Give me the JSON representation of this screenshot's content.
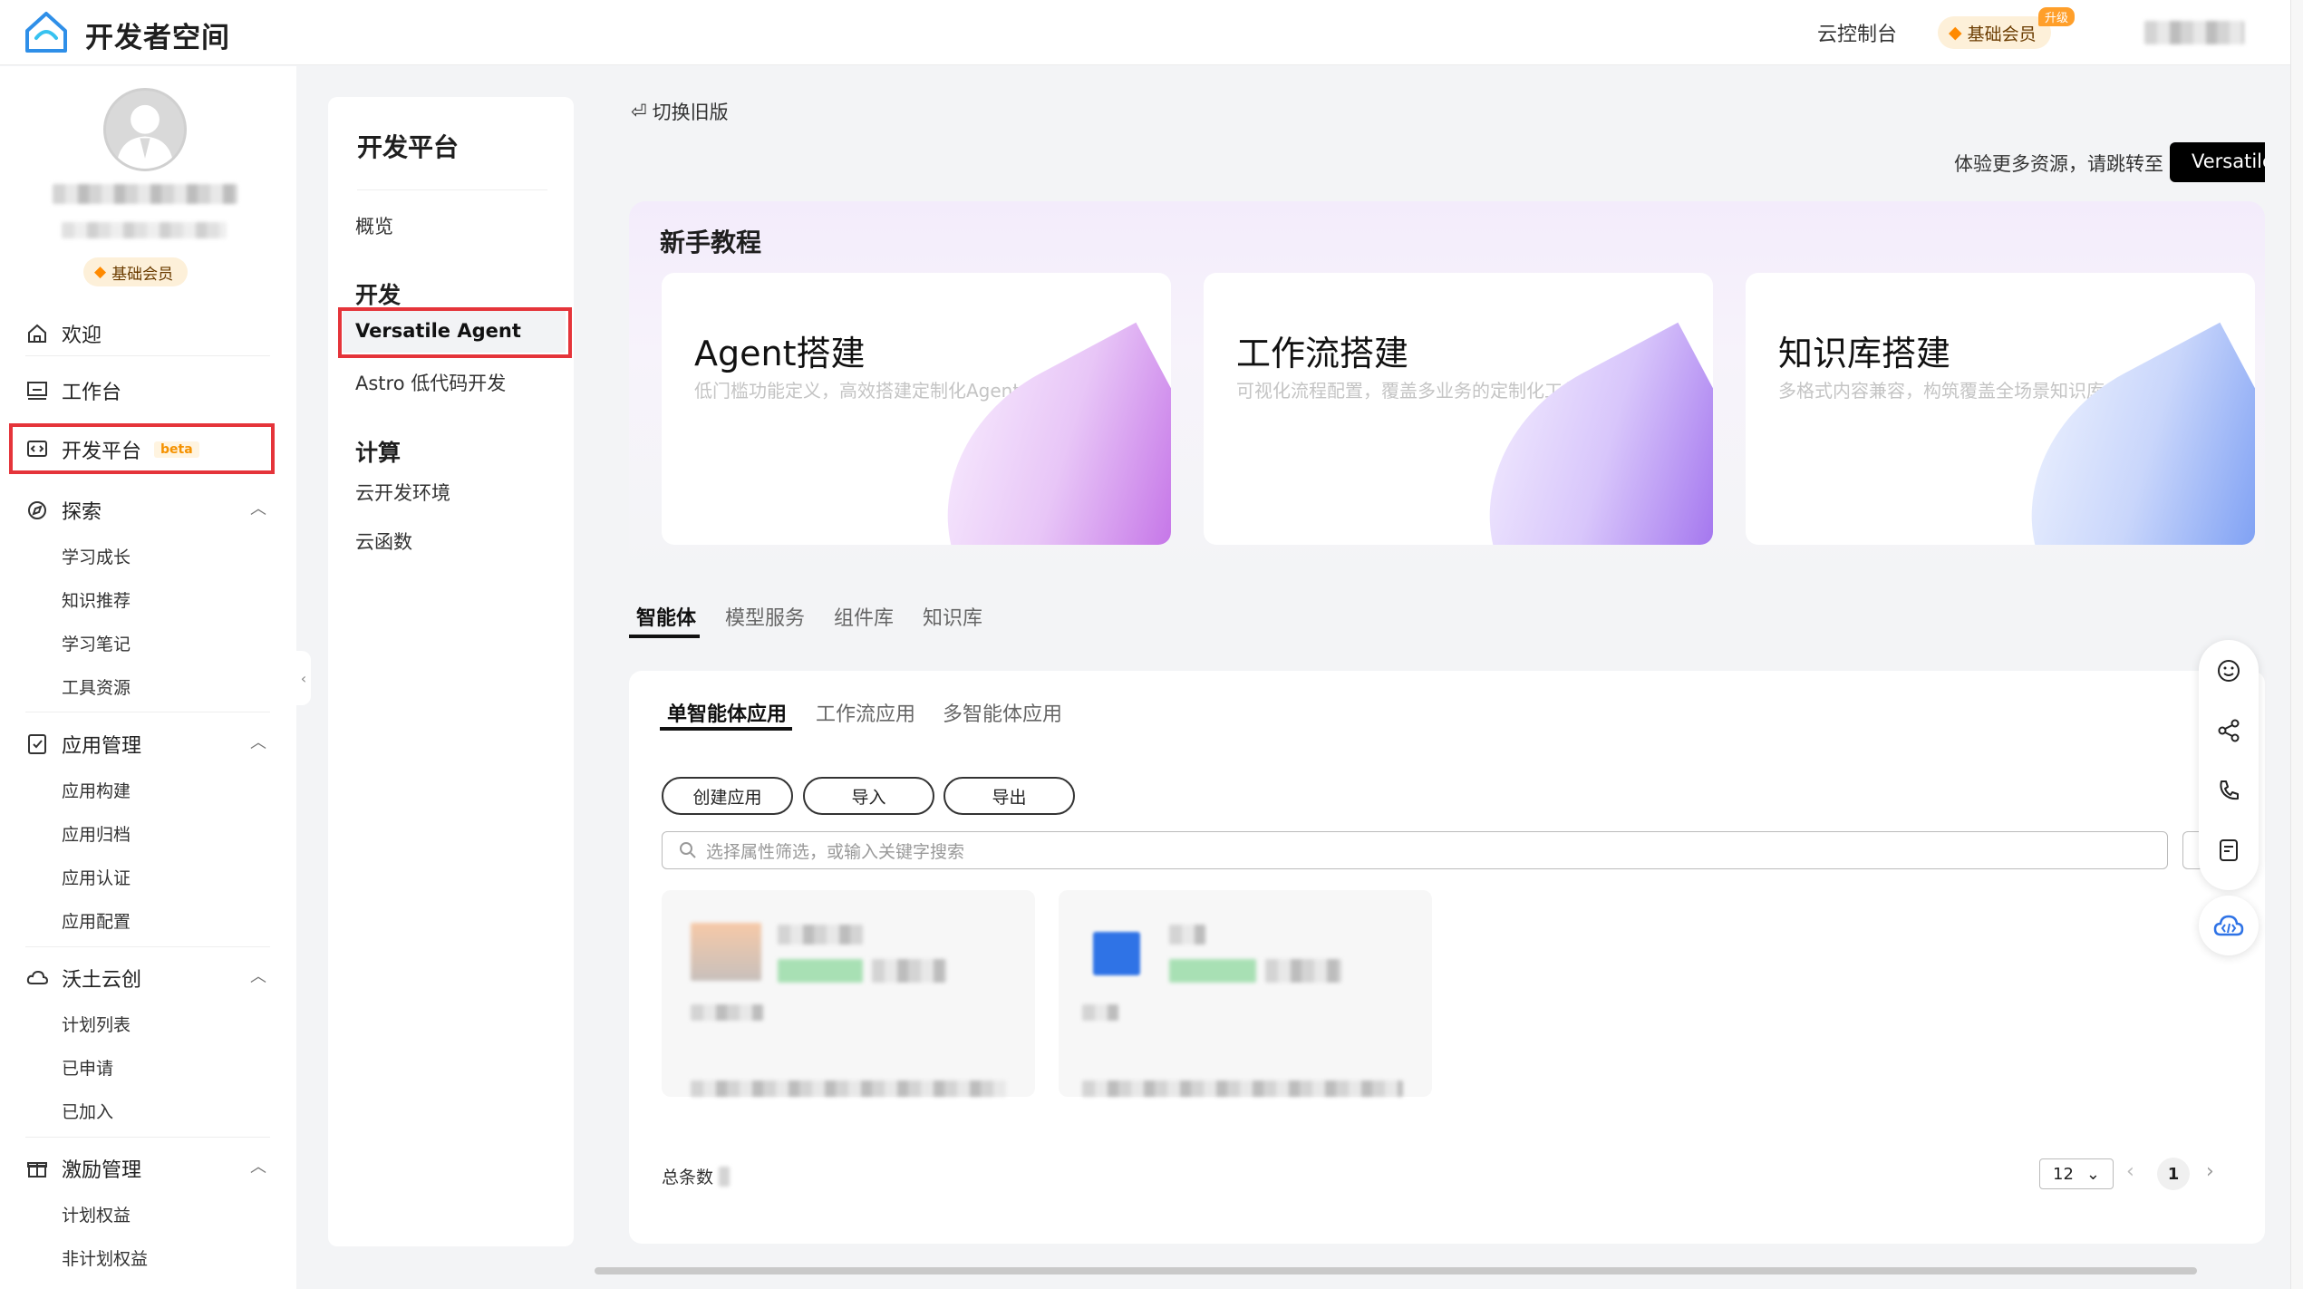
{
  "header": {
    "logo_text": "开发者空间",
    "console_label": "云控制台",
    "member_label": "基础会员",
    "upgrade_badge": "升级"
  },
  "profile": {
    "member_label": "基础会员"
  },
  "sidebar": {
    "items": [
      {
        "label": "欢迎",
        "icon": "home-icon"
      },
      {
        "label": "工作台",
        "icon": "dashboard-icon"
      },
      {
        "label": "开发平台",
        "icon": "code-window-icon",
        "badge": "beta"
      },
      {
        "label": "探索",
        "icon": "explore-icon",
        "children": [
          "学习成长",
          "知识推荐",
          "学习笔记",
          "工具资源"
        ]
      },
      {
        "label": "应用管理",
        "icon": "app-manage-icon",
        "children": [
          "应用构建",
          "应用归档",
          "应用认证",
          "应用配置"
        ]
      },
      {
        "label": "沃土云创",
        "icon": "cloud-create-icon",
        "children": [
          "计划列表",
          "已申请",
          "已加入"
        ]
      },
      {
        "label": "激励管理",
        "icon": "gift-icon",
        "children": [
          "计划权益",
          "非计划权益"
        ]
      }
    ]
  },
  "panel2": {
    "title": "开发平台",
    "overview": "概览",
    "group_dev": "开发",
    "dev_items": [
      "Versatile Agent",
      "Astro 低代码开发"
    ],
    "group_compute": "计算",
    "compute_items": [
      "云开发环境",
      "云函数"
    ]
  },
  "main": {
    "switch_old": "切换旧版",
    "promo_text": "体验更多资源，请跳转至",
    "promo_button": "Versatile",
    "tutorial": {
      "title": "新手教程",
      "cards": [
        {
          "title": "Agent搭建",
          "subtitle": "低门槛功能定义，高效搭建定制化Agent"
        },
        {
          "title": "工作流搭建",
          "subtitle": "可视化流程配置，覆盖多业务的定制化工作流"
        },
        {
          "title": "知识库搭建",
          "subtitle": "多格式内容兼容，构筑覆盖全场景知识库"
        }
      ]
    },
    "tabs": [
      "智能体",
      "模型服务",
      "组件库",
      "知识库"
    ],
    "subtabs": [
      "单智能体应用",
      "工作流应用",
      "多智能体应用"
    ],
    "buttons": {
      "create": "创建应用",
      "import": "导入",
      "export": "导出"
    },
    "search_placeholder": "选择属性筛选，或输入关键字搜索",
    "total_label": "总条数",
    "page_size": "12",
    "current_page": "1"
  },
  "float_toolbar": [
    "smile-icon",
    "share-icon",
    "phone-icon",
    "feedback-icon",
    "cloud-code-icon"
  ]
}
